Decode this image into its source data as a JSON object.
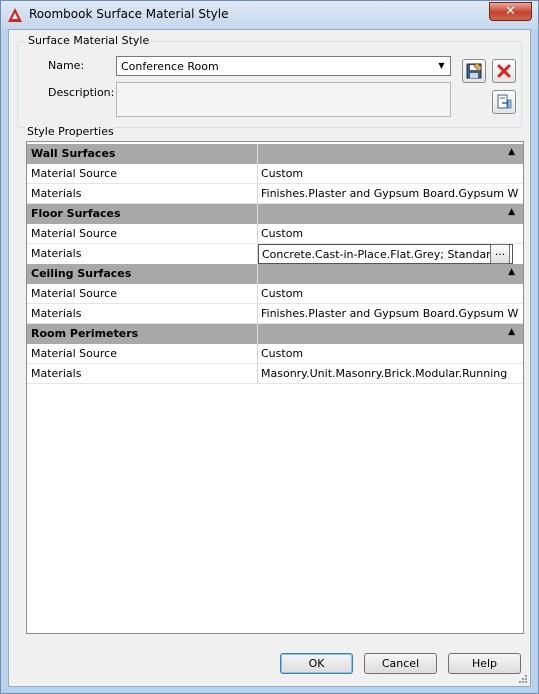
{
  "window": {
    "title": "Roombook Surface Material Style",
    "close_glyph": "✕"
  },
  "surface_material_style": {
    "group_label": "Surface Material Style",
    "name_label": "Name:",
    "name_value": "Conference Room",
    "description_label": "Description:",
    "description_value": ""
  },
  "style_properties": {
    "group_label": "Style Properties",
    "collapse_glyph": "▲",
    "sections": [
      {
        "title": "Wall Surfaces",
        "rows": [
          {
            "name": "Material Source",
            "value": "Custom"
          },
          {
            "name": "Materials",
            "value": "Finishes.Plaster and Gypsum Board.Gypsum W"
          }
        ]
      },
      {
        "title": "Floor Surfaces",
        "rows": [
          {
            "name": "Material Source",
            "value": "Custom"
          },
          {
            "name": "Materials",
            "value": "Concrete.Cast-in-Place.Flat.Grey; Standard"
          }
        ]
      },
      {
        "title": "Ceiling Surfaces",
        "rows": [
          {
            "name": "Material Source",
            "value": "Custom"
          },
          {
            "name": "Materials",
            "value": "Finishes.Plaster and Gypsum Board.Gypsum W"
          }
        ]
      },
      {
        "title": "Room Perimeters",
        "rows": [
          {
            "name": "Material Source",
            "value": "Custom"
          },
          {
            "name": "Materials",
            "value": "Masonry.Unit.Masonry.Brick.Modular.Running"
          }
        ]
      }
    ],
    "ellipsis_label": "..."
  },
  "buttons": {
    "ok": "OK",
    "cancel": "Cancel",
    "help": "Help"
  },
  "icons": {
    "app": "autocad-logo-icon",
    "save": "save-style-icon",
    "delete": "delete-style-icon",
    "import": "import-style-icon"
  },
  "colors": {
    "section_header_bg": "#a8a8a8",
    "delete_red": "#d9261c",
    "window_frame": "#b9d1ea"
  }
}
